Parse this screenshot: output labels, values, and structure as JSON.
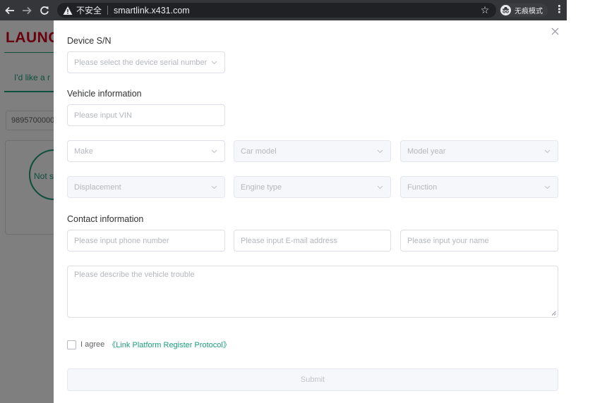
{
  "browser": {
    "insecure_label": "不安全",
    "url": "smartlink.x431.com",
    "profile_label": "无痕模式"
  },
  "background_page": {
    "logo": "LAUNC",
    "tab_label": "I'd like a r",
    "serial_value": "98957000000",
    "status_text": "Not s"
  },
  "dialog": {
    "device_title": "Device S/N",
    "device_placeholder": "Please select the device serial number",
    "vehicle_title": "Vehicle information",
    "vin_placeholder": "Please input VIN",
    "make_placeholder": "Make",
    "car_model_placeholder": "Car model",
    "model_year_placeholder": "Model year",
    "displacement_placeholder": "Displacement",
    "engine_type_placeholder": "Engine type",
    "function_placeholder": "Function",
    "contact_title": "Contact information",
    "phone_placeholder": "Please input phone number",
    "email_placeholder": "Please input E-mail address",
    "name_placeholder": "Please input your name",
    "trouble_placeholder": "Please describe the vehicle trouble",
    "agree_label": "I agree",
    "protocol_link": "《Link Platform Register Protocol》",
    "submit_label": "Submit"
  },
  "colors": {
    "accent": "#1a9e7a",
    "brand": "#d0021b"
  },
  "icons": [
    "back-arrow-icon",
    "forward-arrow-icon",
    "reload-icon",
    "warning-icon",
    "star-icon",
    "incognito-icon",
    "more-vert-icon",
    "close-icon",
    "chevron-down-icon"
  ]
}
